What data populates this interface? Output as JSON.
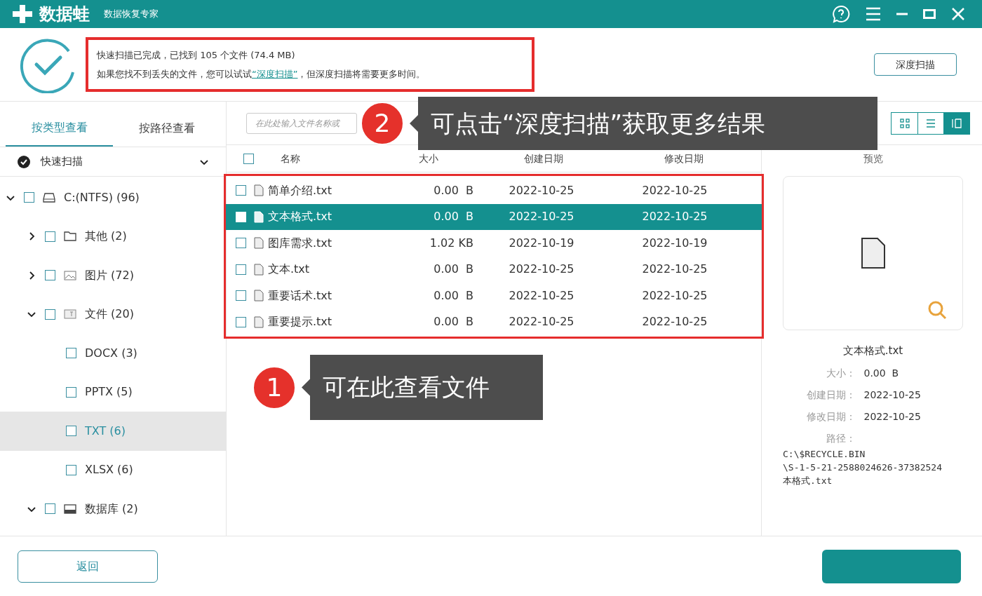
{
  "window": {
    "logo": "数据蛙",
    "subtitle": "数据恢复专家"
  },
  "summary": {
    "line1": "快速扫描已完成，已找到 105 个文件 (74.4 MB)",
    "line2_before": "如果您找不到丢失的文件，您可以试试",
    "link": "“深度扫描”",
    "line2_after": "，但深度扫描将需要更多时间。"
  },
  "deep_scan_button": "深度扫描",
  "sidebar": {
    "tabs": [
      {
        "label": "按类型查看",
        "selected": true
      },
      {
        "label": "按路径查看",
        "selected": false
      }
    ],
    "scan_selector": "快速扫描",
    "tree": [
      {
        "label": "C:(NTFS) (96)",
        "kind": "drive",
        "checked": false,
        "expanded": true,
        "selected": false,
        "children": [
          {
            "label": "其他 (2)",
            "kind": "folder",
            "checked": false,
            "expanded": false,
            "selected": false
          },
          {
            "label": "图片 (72)",
            "kind": "image",
            "checked": false,
            "expanded": false,
            "selected": false
          },
          {
            "label": "文件 (20)",
            "kind": "document",
            "checked": false,
            "expanded": true,
            "selected": false,
            "children": [
              {
                "label": "DOCX (3)",
                "checked": false,
                "selected": false
              },
              {
                "label": "PPTX (5)",
                "checked": false,
                "selected": false
              },
              {
                "label": "TXT (6)",
                "checked": false,
                "selected": true
              },
              {
                "label": "XLSX (6)",
                "checked": false,
                "selected": false
              }
            ]
          },
          {
            "label": "数据库 (2)",
            "kind": "database",
            "checked": false,
            "expanded": true,
            "selected": false
          }
        ]
      }
    ]
  },
  "search": {
    "placeholder": "在此处输入文件名称或"
  },
  "view_modes": [
    {
      "kind": "grid",
      "selected": false
    },
    {
      "kind": "list",
      "selected": false
    },
    {
      "kind": "detail",
      "selected": true
    }
  ],
  "table": {
    "select_all_checked": false,
    "columns": [
      "名称",
      "大小",
      "创建日期",
      "修改日期"
    ],
    "rows": [
      {
        "name": "简单介绍.txt",
        "size": "0.00  B",
        "created": "2022-10-25",
        "modified": "2022-10-25",
        "checked": false,
        "selected": false
      },
      {
        "name": "文本格式.txt",
        "size": "0.00  B",
        "created": "2022-10-25",
        "modified": "2022-10-25",
        "checked": false,
        "selected": true
      },
      {
        "name": "图库需求.txt",
        "size": "1.02 KB",
        "created": "2022-10-19",
        "modified": "2022-10-19",
        "checked": false,
        "selected": false
      },
      {
        "name": "文本.txt",
        "size": "0.00  B",
        "created": "2022-10-25",
        "modified": "2022-10-25",
        "checked": false,
        "selected": false
      },
      {
        "name": "重要话术.txt",
        "size": "0.00  B",
        "created": "2022-10-25",
        "modified": "2022-10-25",
        "checked": false,
        "selected": false
      },
      {
        "name": "重要提示.txt",
        "size": "0.00  B",
        "created": "2022-10-25",
        "modified": "2022-10-25",
        "checked": false,
        "selected": false
      }
    ]
  },
  "preview": {
    "title": "预览",
    "file_name": "文本格式.txt",
    "fields": [
      {
        "label": "大小：",
        "value": "0.00  B"
      },
      {
        "label": "创建日期：",
        "value": "2022-10-25"
      },
      {
        "label": "修改日期：",
        "value": "2022-10-25"
      },
      {
        "label": "路径："
      }
    ],
    "path_lines": [
      "C:\\$RECYCLE.BIN",
      "\\S-1-5-21-2588024626-37382524",
      "本格式.txt"
    ]
  },
  "back_button": "返回",
  "annotations": [
    {
      "number": "1",
      "text": "可在此查看文件"
    },
    {
      "number": "2",
      "text": "可点击“深度扫描”获取更多结果"
    }
  ]
}
